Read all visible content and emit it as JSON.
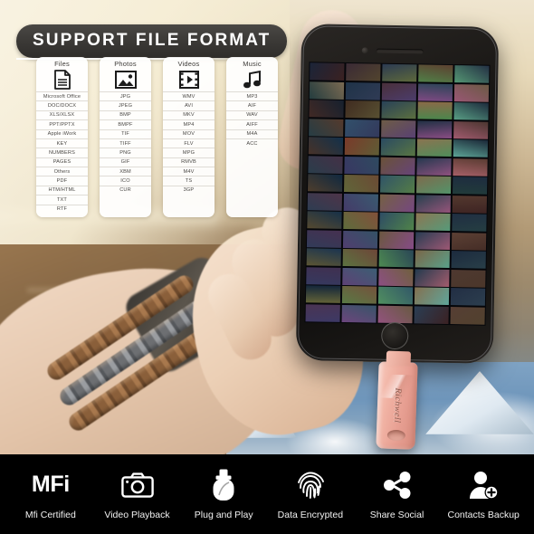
{
  "banner": {
    "title": "SUPPORT FILE FORMAT"
  },
  "format_cards": [
    {
      "title": "Files",
      "icon": "document-icon",
      "items": [
        "Microsoft Office",
        "DOC/DOCX",
        "XLS/XLSX",
        "PPT/PPTX",
        "Apple iWork",
        "KEY",
        "NUMBERS",
        "PAGES",
        "Others",
        "PDF",
        "HTM/HTML",
        "TXT",
        "RTF"
      ]
    },
    {
      "title": "Photos",
      "icon": "image-icon",
      "items": [
        "JPG",
        "JPEG",
        "BMP",
        "BMPF",
        "TIF",
        "TIFF",
        "PNG",
        "GIF",
        "XBM",
        "ICO",
        "CUR"
      ]
    },
    {
      "title": "Videos",
      "icon": "film-play-icon",
      "items": [
        "WMV",
        "AVI",
        "MKV",
        "MP4",
        "MOV",
        "FLV",
        "MPG",
        "RMVB",
        "M4V",
        "TS",
        "3GP"
      ]
    },
    {
      "title": "Music",
      "icon": "music-note-icon",
      "items": [
        "MP3",
        "AIF",
        "WAV",
        "AIFF",
        "M4A",
        "ACC"
      ]
    }
  ],
  "product": {
    "brand": "Richwell"
  },
  "features": [
    {
      "label": "Mfi Certified",
      "icon": "mfi-text-icon",
      "text": "MFi"
    },
    {
      "label": "Video Playback",
      "icon": "camera-icon"
    },
    {
      "label": "Plug and Play",
      "icon": "usb-drive-icon"
    },
    {
      "label": "Data Encrypted",
      "icon": "fingerprint-icon"
    },
    {
      "label": "Share Social",
      "icon": "share-nodes-icon"
    },
    {
      "label": "Contacts Backup",
      "icon": "contact-add-icon"
    }
  ],
  "colors": {
    "banner_bg": "#3a3835",
    "bar_bg": "#000000",
    "card_bg": "#ffffff",
    "drive_body": "#f1b3a4",
    "background_cream": "#f6eed6"
  },
  "phone": {
    "screen_content": "photo-gallery-grid",
    "thumbnail_colors": [
      "#1b2438",
      "#3a2a35",
      "#2b3a52",
      "#5d4030",
      "#243044",
      "#7a6a52",
      "#1f3348",
      "#4a2f3a",
      "#2c4457",
      "#6b5a44",
      "#16202e",
      "#3f2b20",
      "#284158",
      "#8a6a48",
      "#1d2b3c",
      "#553a2c",
      "#32506b",
      "#6e5c46",
      "#203044",
      "#4b3630",
      "#12304a",
      "#7a3a2a",
      "#2a4a62",
      "#8b7350",
      "#1a2636",
      "#443046",
      "#2f4a60",
      "#6a5238",
      "#24384e",
      "#5a3c32",
      "#0f2840",
      "#6b4a34",
      "#305468",
      "#7e6a4c",
      "#1e2c40",
      "#4e3448",
      "#3a5a70",
      "#756044",
      "#26404e",
      "#53382e",
      "#163048",
      "#82503a",
      "#2e4c64",
      "#8c7652",
      "#202e42",
      "#463050",
      "#345266",
      "#6c5840",
      "#283c52",
      "#5c4034",
      "#1a3450",
      "#6e4638",
      "#2a4656",
      "#7a6648",
      "#1c2a3e",
      "#403050",
      "#3c5e74",
      "#70603e",
      "#223a4e",
      "#4e3830",
      "#13263a",
      "#75523c",
      "#325868",
      "#847050",
      "#222e44",
      "#4a3452",
      "#385468",
      "#685a42",
      "#2a3e54",
      "#563e34"
    ]
  }
}
